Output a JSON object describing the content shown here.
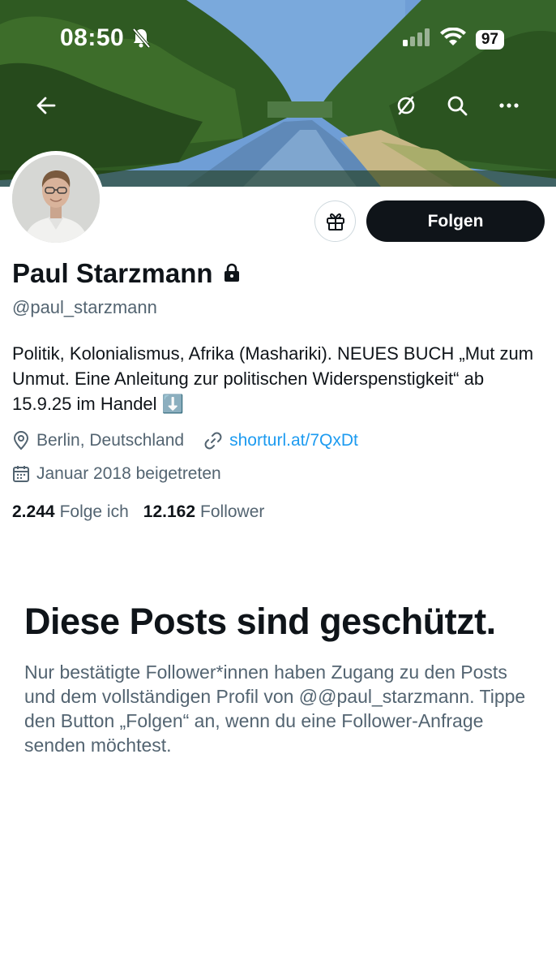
{
  "status_bar": {
    "time": "08:50",
    "battery": "97",
    "bell_icon": "bell-slash-icon",
    "signal_icon": "signal-icon",
    "wifi_icon": "wifi-icon"
  },
  "nav": {
    "back_icon": "arrow-left-icon",
    "grok_icon": "slashed-circle-icon",
    "search_icon": "search-icon",
    "more_icon": "more-horizontal-icon"
  },
  "profile": {
    "display_name": "Paul Starzmann",
    "handle": "@paul_starzmann",
    "bio": "Politik, Kolonialismus, Afrika (Mashariki). NEUES BUCH „Mut zum Unmut. Eine Anleitung zur politischen Widerspenstigkeit“ ab 15.9.25 im Handel ⬇️",
    "location": "Berlin, Deutschland",
    "link": "shorturl.at/7QxDt",
    "joined": "Januar 2018 beigetreten",
    "following_count": "2.244",
    "following_label": "Folge ich",
    "followers_count": "12.162",
    "followers_label": "Follower"
  },
  "actions": {
    "follow_label": "Folgen",
    "gift_icon": "gift-icon"
  },
  "protected": {
    "title": "Diese Posts sind geschützt.",
    "text": "Nur bestätigte Follower*innen haben Zugang zu den Posts und dem vollständigen Profil von @@paul_starzmann. Tippe den Button „Folgen“ an, wenn du eine Follower-Anfrage senden möchtest."
  },
  "colors": {
    "text": "#0f1419",
    "secondary": "#536471",
    "link": "#1d9bf0",
    "button_bg": "#0f1419"
  }
}
